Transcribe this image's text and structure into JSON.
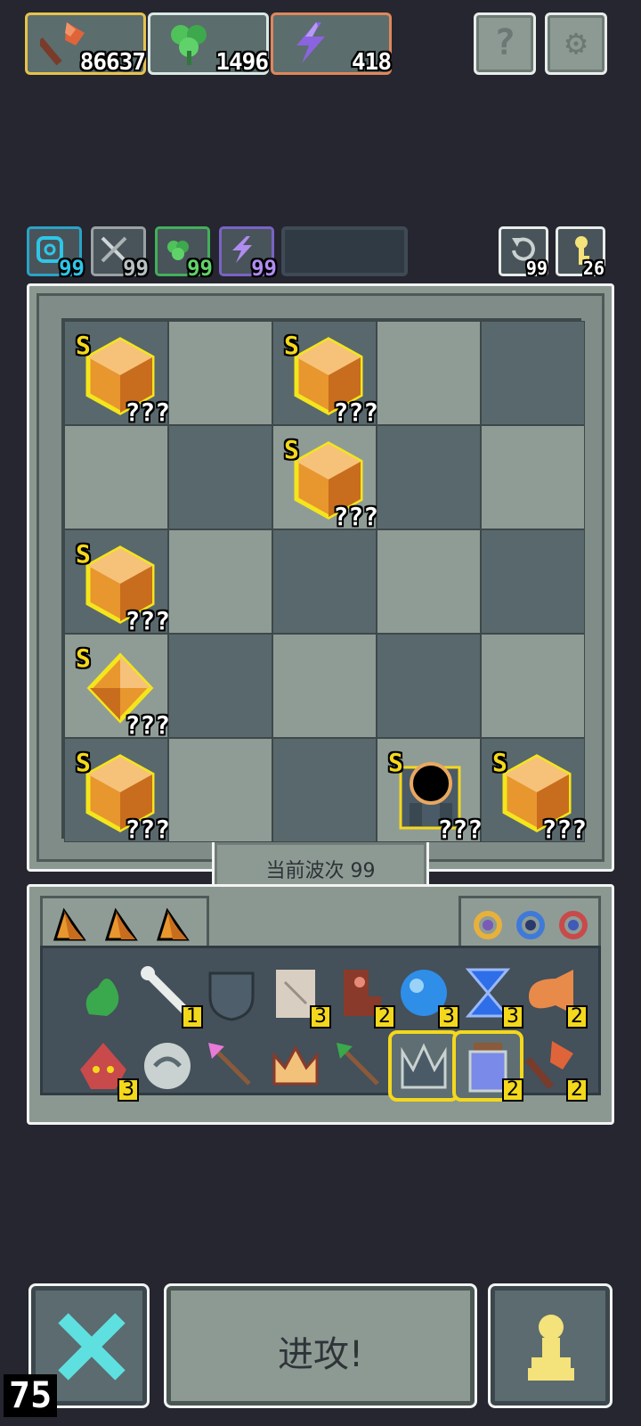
{
  "currencies": [
    {
      "name": "axe-resource",
      "value": "86637",
      "border": "#e7c24c"
    },
    {
      "name": "clover-resource",
      "value": "1496",
      "border": "#d9e8e2"
    },
    {
      "name": "energy-resource",
      "value": "418",
      "border": "#e0875a"
    }
  ],
  "top_buttons": {
    "help": "?",
    "settings": "⚙"
  },
  "stats": [
    {
      "name": "shield-stat",
      "value": "99",
      "border": "#29a3c8",
      "color": "#2ec6e8"
    },
    {
      "name": "swords-stat",
      "value": "99",
      "border": "#9aa2a4",
      "color": "#b8c0c2"
    },
    {
      "name": "clover-stat",
      "value": "99",
      "border": "#42b05a",
      "color": "#5fd36a"
    },
    {
      "name": "energy-stat",
      "value": "99",
      "border": "#7a63c6",
      "color": "#b08cf2"
    }
  ],
  "mini": [
    {
      "name": "refresh-counter",
      "value": "99"
    },
    {
      "name": "key-counter",
      "value": "26"
    }
  ],
  "board": {
    "units": [
      {
        "row": 0,
        "col": 0,
        "rank": "S",
        "label": "???",
        "kind": "cube"
      },
      {
        "row": 0,
        "col": 2,
        "rank": "S",
        "label": "???",
        "kind": "cube"
      },
      {
        "row": 1,
        "col": 2,
        "rank": "S",
        "label": "???",
        "kind": "cube"
      },
      {
        "row": 2,
        "col": 0,
        "rank": "S",
        "label": "???",
        "kind": "cube"
      },
      {
        "row": 3,
        "col": 0,
        "rank": "S",
        "label": "???",
        "kind": "diamond"
      },
      {
        "row": 4,
        "col": 0,
        "rank": "S",
        "label": "???",
        "kind": "cube"
      },
      {
        "row": 4,
        "col": 3,
        "rank": "S",
        "label": "???",
        "kind": "portal"
      },
      {
        "row": 4,
        "col": 4,
        "rank": "S",
        "label": "???",
        "kind": "cube"
      }
    ],
    "wave_label": "当前波次 99"
  },
  "inventory": {
    "items": [
      {
        "name": "green-slime-item",
        "count": ""
      },
      {
        "name": "bone-item",
        "count": "1"
      },
      {
        "name": "shield-item",
        "count": ""
      },
      {
        "name": "scroll-item",
        "count": "3"
      },
      {
        "name": "boot-item",
        "count": "2"
      },
      {
        "name": "blue-orb-item",
        "count": "3"
      },
      {
        "name": "hourglass-item",
        "count": "3"
      },
      {
        "name": "horn-item",
        "count": "2"
      },
      {
        "name": "demon-mask-item",
        "count": "3"
      },
      {
        "name": "swirl-stone-item",
        "count": ""
      },
      {
        "name": "pink-arrow-item",
        "count": ""
      },
      {
        "name": "crown-item",
        "count": ""
      },
      {
        "name": "green-arrow-item",
        "count": ""
      },
      {
        "name": "spike-crown-item",
        "count": ""
      },
      {
        "name": "potion-item",
        "count": "2"
      },
      {
        "name": "axe-item",
        "count": "2"
      }
    ]
  },
  "bottom": {
    "attack_label": "进攻!",
    "level": "75"
  }
}
